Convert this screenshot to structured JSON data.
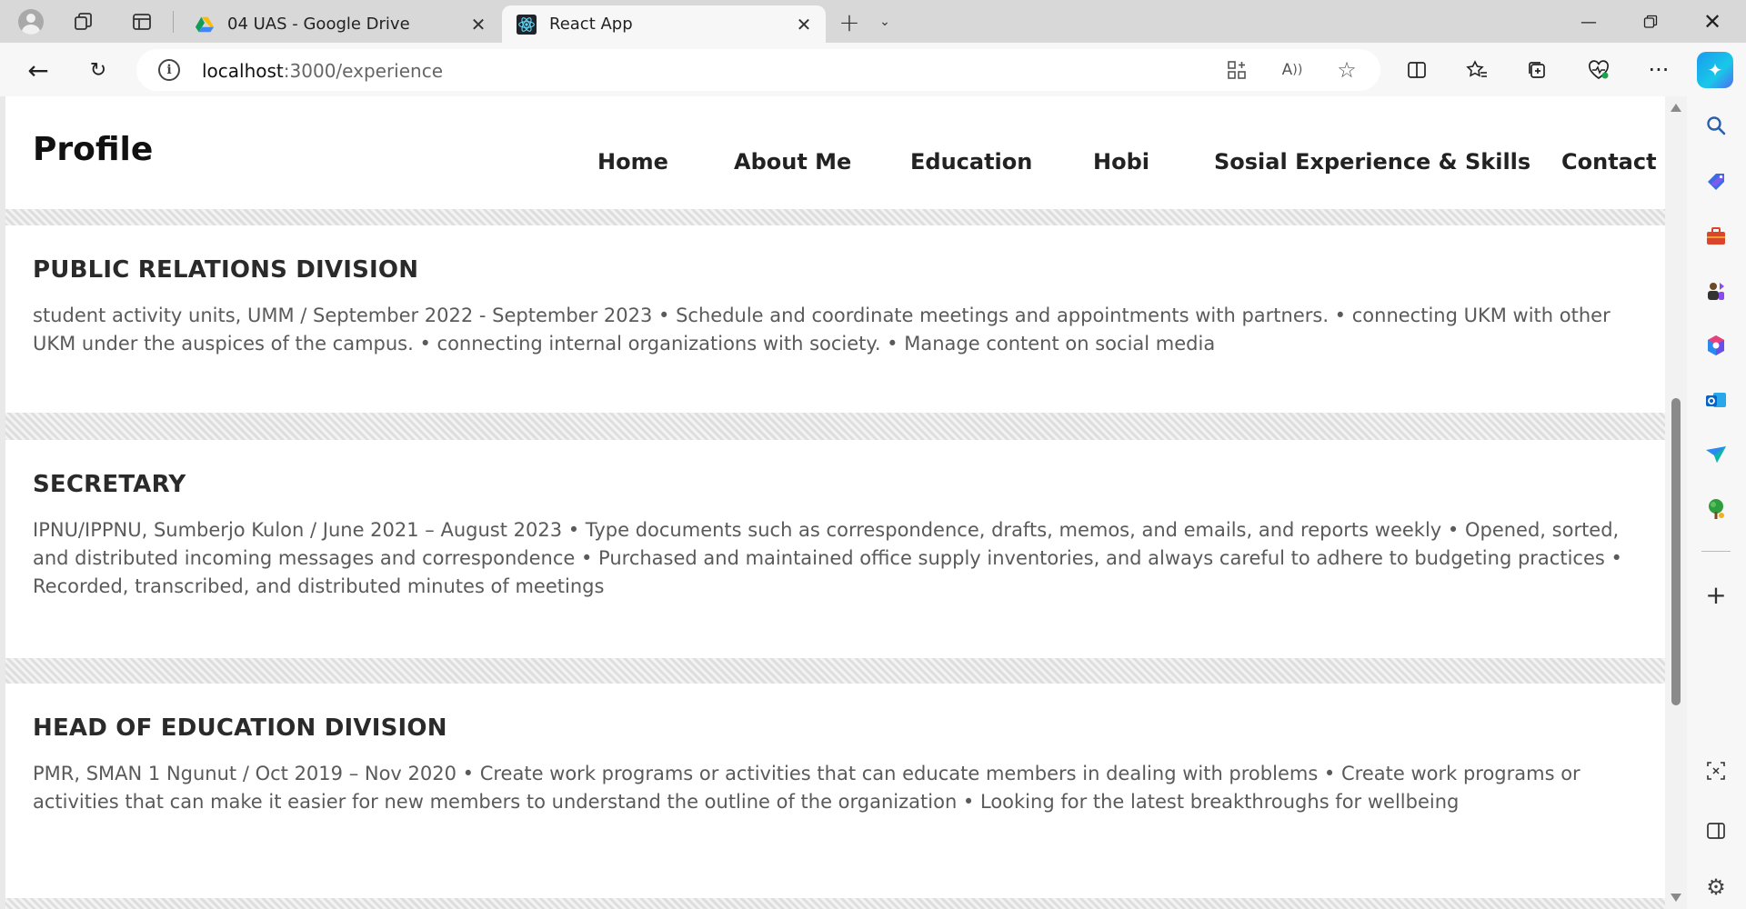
{
  "browser": {
    "tabs": [
      {
        "title": "04 UAS - Google Drive",
        "favicon": "google-drive-icon",
        "active": false
      },
      {
        "title": "React App",
        "favicon": "react-icon",
        "active": true
      }
    ],
    "url": {
      "host": "localhost",
      "path": ":3000/experience"
    },
    "accent": "#1a9bf0"
  },
  "site": {
    "brand": "Profile",
    "nav": [
      "Home",
      "About Me",
      "Education",
      "Hobi",
      "Sosial Experience & Skills",
      "Contact"
    ]
  },
  "experiences": [
    {
      "title": "PUBLIC RELATIONS DIVISION",
      "description": "student activity units, UMM / September 2022 - September 2023 • Schedule and coordinate meetings and appointments with partners. • connecting UKM with other UKM under the auspices of the campus. • connecting internal organizations with society. • Manage content on social media"
    },
    {
      "title": "SECRETARY",
      "description": "IPNU/IPPNU, Sumberjo Kulon / June 2021 – August 2023 • Type documents such as correspondence, drafts, memos, and emails, and reports weekly • Opened, sorted, and distributed incoming messages and correspondence • Purchased and maintained office supply inventories, and always careful to adhere to budgeting practices • Recorded, transcribed, and distributed minutes of meetings"
    },
    {
      "title": "HEAD OF EDUCATION DIVISION",
      "description": "PMR, SMAN 1 Ngunut / Oct 2019 – Nov 2020 • Create work programs or activities that can educate members in dealing with problems • Create work programs or activities that can make it easier for new members to understand the outline of the organization • Looking for the latest breakthroughs for wellbeing"
    }
  ]
}
